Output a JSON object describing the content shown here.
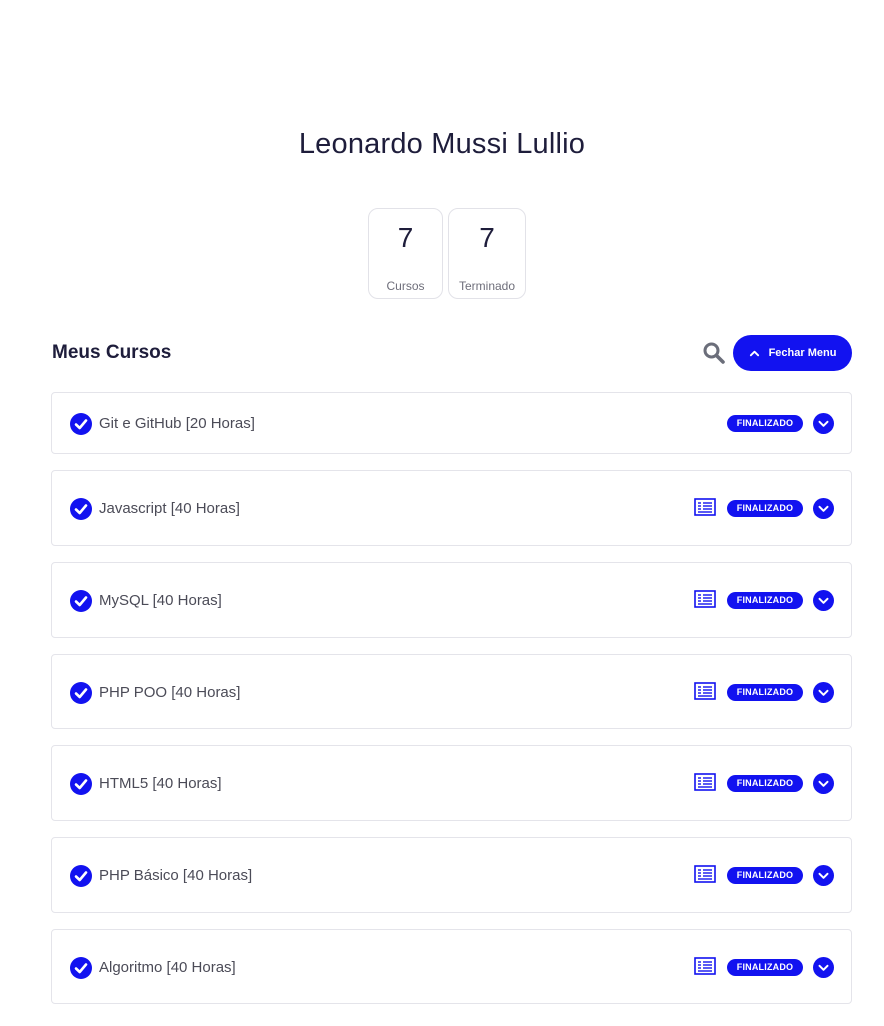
{
  "profile": {
    "name": "Leonardo Mussi Lullio"
  },
  "stats": {
    "courses": {
      "value": "7",
      "label": "Cursos"
    },
    "finished": {
      "value": "7",
      "label": "Terminado"
    }
  },
  "section": {
    "title": "Meus Cursos",
    "toggle_label": "Fechar Menu"
  },
  "colors": {
    "accent": "#1212f0",
    "border": "#e4e4ea",
    "text": "#1e1d3b"
  },
  "courses": [
    {
      "name": "Git e GitHub [20 Horas]",
      "status": "FINALIZADO",
      "has_certificate": false
    },
    {
      "name": "Javascript [40 Horas]",
      "status": "FINALIZADO",
      "has_certificate": true
    },
    {
      "name": "MySQL [40 Horas]",
      "status": "FINALIZADO",
      "has_certificate": true
    },
    {
      "name": "PHP POO [40 Horas]",
      "status": "FINALIZADO",
      "has_certificate": true
    },
    {
      "name": "HTML5 [40 Horas]",
      "status": "FINALIZADO",
      "has_certificate": true
    },
    {
      "name": "PHP Básico [40 Horas]",
      "status": "FINALIZADO",
      "has_certificate": true
    },
    {
      "name": "Algoritmo [40 Horas]",
      "status": "FINALIZADO",
      "has_certificate": true
    }
  ]
}
